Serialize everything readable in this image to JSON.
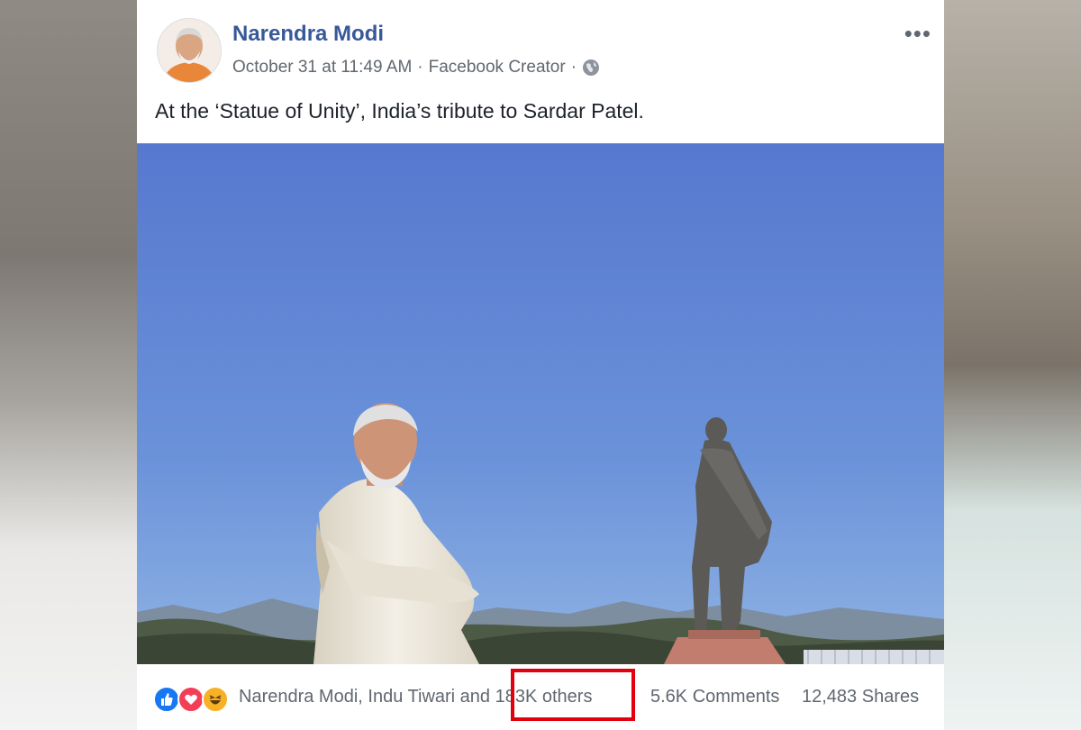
{
  "post": {
    "author": "Narendra Modi",
    "date": "October 31 at 11:49 AM",
    "separator": "·",
    "via": "Facebook Creator",
    "separator2": "·",
    "privacy_icon": "globe-icon",
    "more_label": "•••",
    "text": "At the ‘Statue of Unity’, India’s tribute to Sardar Patel."
  },
  "reactions": {
    "icons": [
      "like-icon",
      "love-icon",
      "haha-icon"
    ],
    "names": "Narendra Modi, Indu Tiwari and ",
    "others": "183K others",
    "comments": "5.6K Comments",
    "shares": "12,483 Shares"
  },
  "colors": {
    "author_blue": "#385898",
    "like_blue": "#1877f2",
    "love_red": "#f33e58",
    "haha_yellow": "#f7b125",
    "highlight_red": "#e3000e",
    "sky": "#5b83d1"
  }
}
